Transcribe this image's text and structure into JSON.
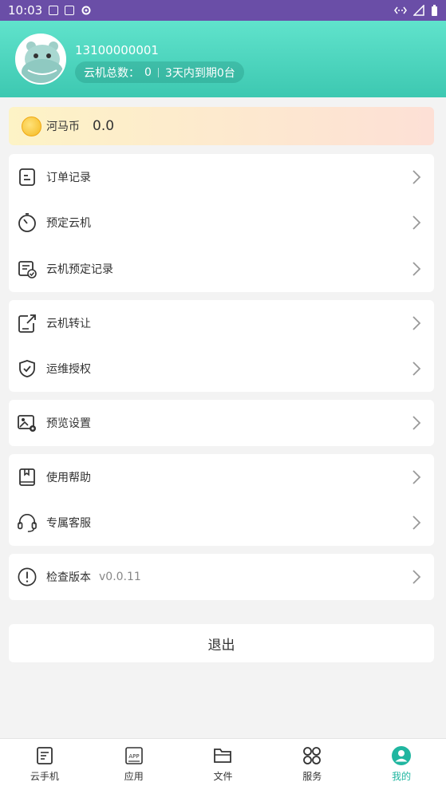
{
  "status_bar": {
    "time": "10:03"
  },
  "profile": {
    "phone": "13100000001",
    "total_label": "云机总数：",
    "total_value": "0",
    "expiring_text": "3天内到期0台"
  },
  "coin": {
    "label": "河马币",
    "value": "0.0"
  },
  "menu_groups": [
    {
      "items": [
        {
          "label": "订单记录",
          "icon": "order-list-icon"
        },
        {
          "label": "预定云机",
          "icon": "timer-icon"
        },
        {
          "label": "云机预定记录",
          "icon": "booking-record-icon"
        }
      ]
    },
    {
      "items": [
        {
          "label": "云机转让",
          "icon": "transfer-icon"
        },
        {
          "label": "运维授权",
          "icon": "shield-check-icon"
        }
      ]
    },
    {
      "items": [
        {
          "label": "预览设置",
          "icon": "image-settings-icon"
        }
      ]
    },
    {
      "items": [
        {
          "label": "使用帮助",
          "icon": "help-book-icon"
        },
        {
          "label": "专属客服",
          "icon": "headset-icon"
        }
      ]
    },
    {
      "items": [
        {
          "label": "检查版本",
          "version": "v0.0.11",
          "icon": "info-circle-icon"
        }
      ]
    }
  ],
  "logout_label": "退出",
  "tabs": [
    {
      "label": "云手机",
      "icon": "cloud-phone-icon",
      "active": false
    },
    {
      "label": "应用",
      "icon": "app-icon",
      "active": false
    },
    {
      "label": "文件",
      "icon": "folder-icon",
      "active": false
    },
    {
      "label": "服务",
      "icon": "grid-icon",
      "active": false
    },
    {
      "label": "我的",
      "icon": "user-icon",
      "active": true
    }
  ],
  "colors": {
    "accent": "#20b6a0",
    "header": "#4fd6be",
    "statusbar": "#6a4ea7"
  }
}
